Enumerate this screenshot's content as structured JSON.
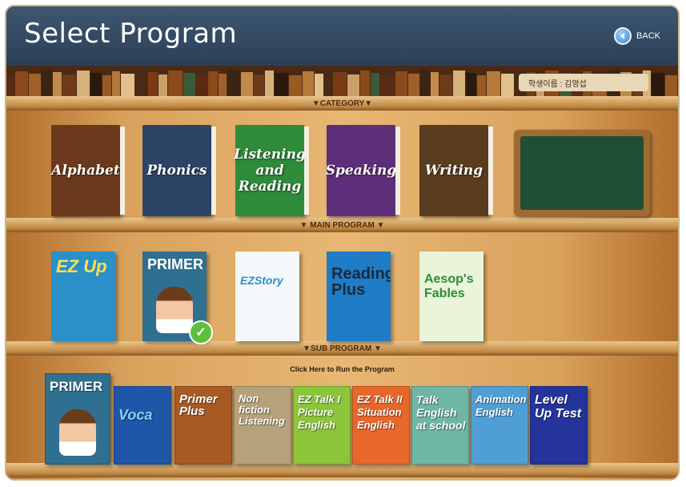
{
  "header": {
    "title": "Select Program",
    "back_label": "BACK"
  },
  "student": {
    "label": "학생이름 : 김영섭"
  },
  "shelves": {
    "category_label": "▼CATEGORY▼",
    "main_label": "▼ MAIN PROGRAM ▼",
    "sub_label": "▼SUB PROGRAM ▼",
    "click_here": "Click Here to Run the Program"
  },
  "categories": [
    {
      "label": "Alphabet",
      "color": "#6b3a1c"
    },
    {
      "label": "Phonics",
      "color": "#2e4466"
    },
    {
      "label": "Listening and Reading",
      "color": "#2f8a3a"
    },
    {
      "label": "Speaking",
      "color": "#5d2f7a"
    },
    {
      "label": "Writing",
      "color": "#5a3c1e"
    }
  ],
  "main_programs": [
    {
      "title": "EZ Up",
      "color": "#2b8fc9"
    },
    {
      "title": "PRIMER",
      "color": "#2f6f8f"
    },
    {
      "title": "EZStory",
      "color": "#f4f8fb"
    },
    {
      "title": "Reading Plus",
      "color": "#1f7cc6"
    },
    {
      "title": "Aesop's Fables",
      "color": "#e9f4d8"
    }
  ],
  "sub_programs": [
    {
      "title": "PRIMER",
      "color": "#2f6f8f"
    },
    {
      "title": "Voca",
      "color": "#1f56a8"
    },
    {
      "title": "Primer Plus",
      "color": "#a75a24"
    },
    {
      "title": "Non fiction Listening",
      "color": "#b5a27a"
    },
    {
      "title": "EZ Talk I Picture English",
      "color": "#8bc53a"
    },
    {
      "title": "EZ Talk II Situation English",
      "color": "#e8672a"
    },
    {
      "title": "Talk English at school",
      "color": "#6fb7a4"
    },
    {
      "title": "Animation English",
      "color": "#4f9fd6"
    },
    {
      "title": "Level Up Test",
      "color": "#24349a"
    }
  ]
}
